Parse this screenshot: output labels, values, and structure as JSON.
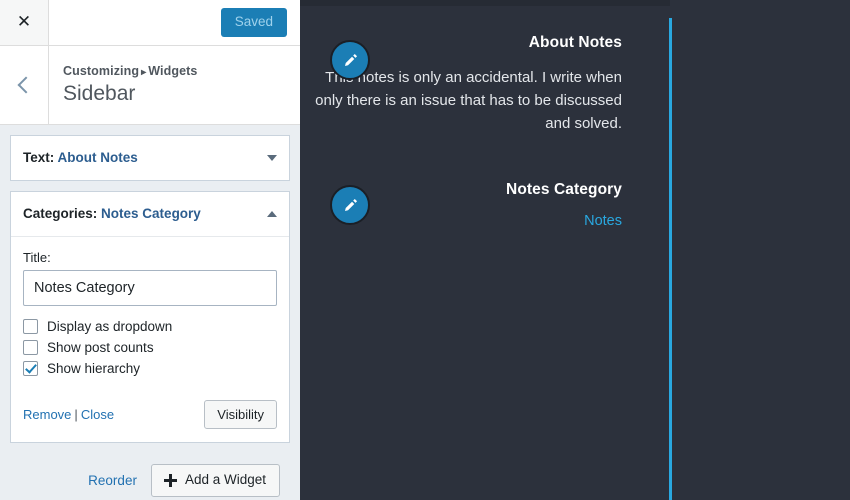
{
  "customizer": {
    "close_icon": "close-x-icon",
    "save_button_label": "Saved",
    "back_icon": "chevron-left-icon",
    "breadcrumb": {
      "root": "Customizing",
      "separator": "▸",
      "parent": "Widgets"
    },
    "section_title": "Sidebar",
    "widgets": [
      {
        "type_label": "Text:",
        "instance_name": "About Notes",
        "expanded": false,
        "toggle_icon": "chevron-down-icon"
      },
      {
        "type_label": "Categories:",
        "instance_name": "Notes Category",
        "expanded": true,
        "toggle_icon": "chevron-up-icon",
        "form": {
          "title_label": "Title:",
          "title_value": "Notes Category",
          "title_placeholder": "Title",
          "checkboxes": [
            {
              "label": "Display as dropdown",
              "checked": false
            },
            {
              "label": "Show post counts",
              "checked": false
            },
            {
              "label": "Show hierarchy",
              "checked": true
            }
          ],
          "remove_label": "Remove",
          "separator": "|",
          "close_label": "Close",
          "visibility_label": "Visibility"
        }
      }
    ],
    "footer": {
      "reorder_label": "Reorder",
      "add_widget_label": "Add a Widget",
      "add_widget_icon": "plus-icon"
    }
  },
  "preview": {
    "accent_color": "#29a8e0",
    "background_color": "#2c313c",
    "edit_icon": "pencil-icon",
    "widgets": [
      {
        "title": "About Notes",
        "body": "This notes is only an accidental. I write when only there is an issue that has to be discussed and solved."
      },
      {
        "title": "Notes Category",
        "links": [
          "Notes"
        ]
      }
    ]
  }
}
